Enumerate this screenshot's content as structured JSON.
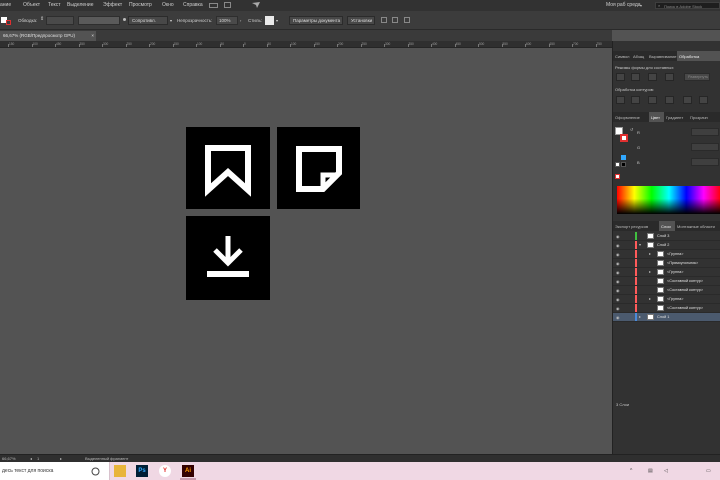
{
  "menu": {
    "items": [
      "ание",
      "Объект",
      "Текст",
      "Выделение",
      "Эффект",
      "Просмотр",
      "Окно",
      "Справка"
    ],
    "user": "Моя раб среда",
    "search_placeholder": "Поиск в Adobe Stock"
  },
  "control": {
    "stroke_label": "Обводка:",
    "style_label": "Стиль:",
    "brush_value": "Сопротивл.",
    "opacity_label": "Непрозрачность:",
    "opacity_value": "100%",
    "doc_setup": "Параметры документа",
    "prefs": "Установки"
  },
  "document": {
    "tab_label": "66,67% (RGB/Предпросмотр GPU)",
    "close_glyph": "×"
  },
  "ruler": {
    "labels": [
      "150",
      "100",
      "450",
      "350",
      "300",
      "250",
      "200",
      "150",
      "100",
      "50",
      "0",
      "50",
      "100",
      "150",
      "200",
      "250",
      "300",
      "350",
      "400",
      "450",
      "500",
      "550",
      "600",
      "650",
      "700",
      "750"
    ]
  },
  "panel_top": {
    "tabs": [
      "Символ",
      "Абзац",
      "Выравнивание",
      "Обработка"
    ],
    "active": 3,
    "section1": "Режимы формы для составных:",
    "section2": "Обработка контуров:",
    "expand": "Развернуть"
  },
  "color_panel": {
    "tabs": [
      "Оформление",
      "Цвет",
      "Градиент",
      "Прозрачн"
    ],
    "active": 1,
    "channels": [
      "R",
      "G",
      "B"
    ]
  },
  "layers_panel": {
    "tabs": [
      "Экспорт ресурсов",
      "Слои",
      "Монтажные области"
    ],
    "active": 1,
    "rows": [
      {
        "name": "Слой 3",
        "color": "#40c040",
        "indent": 0,
        "twisty": "",
        "selected": false
      },
      {
        "name": "Слой 2",
        "color": "#ff5a5a",
        "indent": 0,
        "twisty": "▾",
        "selected": false
      },
      {
        "name": "<Группа>",
        "color": "#ff5a5a",
        "indent": 1,
        "twisty": "▸",
        "selected": false
      },
      {
        "name": "<Прямоугольник>",
        "color": "#ff5a5a",
        "indent": 1,
        "twisty": "",
        "selected": false
      },
      {
        "name": "<Группа>",
        "color": "#ff5a5a",
        "indent": 1,
        "twisty": "▸",
        "selected": false
      },
      {
        "name": "<Составной контур>",
        "color": "#ff5a5a",
        "indent": 1,
        "twisty": "",
        "selected": false
      },
      {
        "name": "<Составной контур>",
        "color": "#ff5a5a",
        "indent": 1,
        "twisty": "",
        "selected": false
      },
      {
        "name": "<Группа>",
        "color": "#ff5a5a",
        "indent": 1,
        "twisty": "▸",
        "selected": false
      },
      {
        "name": "<Составной контур>",
        "color": "#ff5a5a",
        "indent": 1,
        "twisty": "",
        "selected": false
      },
      {
        "name": "Слой 1",
        "color": "#4a8ad8",
        "indent": 0,
        "twisty": "▸",
        "selected": true
      }
    ],
    "footer": "3 Слои"
  },
  "status": {
    "zoom": "66,67%",
    "artboard": "1",
    "tool": "Выделенный фрагмент"
  },
  "taskbar": {
    "search_text": "десь текст для поиска"
  },
  "colors": {
    "accent": "#31a8ff",
    "tile": "#000000",
    "selected_row": "#4b5a6e"
  }
}
